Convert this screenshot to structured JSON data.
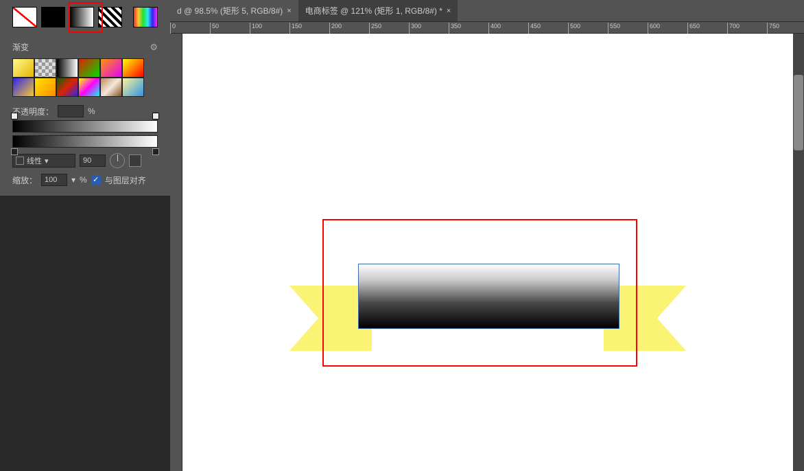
{
  "tabs": [
    {
      "label": "d @ 98.5% (矩形 5, RGB/8#)",
      "active": false
    },
    {
      "label": "电商标签 @ 121% (矩形 1, RGB/8#) *",
      "active": true
    }
  ],
  "ruler_ticks": [
    0,
    50,
    100,
    150,
    200,
    250,
    300,
    350,
    400,
    450,
    500,
    550,
    600,
    650,
    700,
    750
  ],
  "panel": {
    "title": "渐变",
    "opacity_label": "不透明度：",
    "opacity_value": "",
    "opacity_unit": "%",
    "type_label": "线性",
    "angle_value": "90",
    "scale_label": "缩放：",
    "scale_value": "100",
    "scale_unit": "%",
    "align_label": "与图层对齐"
  }
}
